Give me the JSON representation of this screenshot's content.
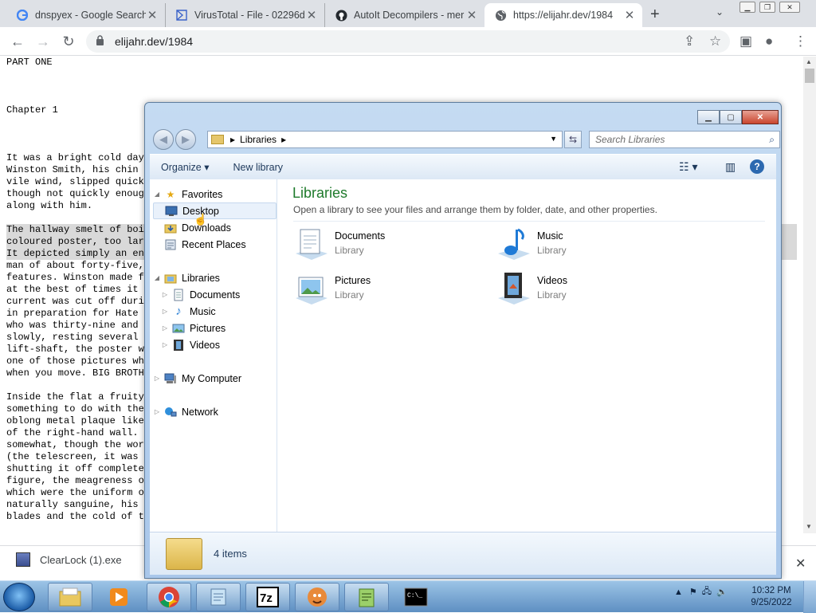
{
  "browser": {
    "tabs": [
      {
        "title": "dnspyex - Google Search",
        "icon": "google-icon"
      },
      {
        "title": "VirusTotal - File - 02296d",
        "icon": "virustotal-icon"
      },
      {
        "title": "AutoIt Decompilers - mer",
        "icon": "github-icon"
      },
      {
        "title": "https://elijahr.dev/1984",
        "icon": "globe-icon",
        "active": true
      }
    ],
    "url": "elijahr.dev/1984"
  },
  "page": {
    "lines": [
      {
        "text": "PART ONE",
        "hl": false
      },
      {
        "text": "",
        "hl": false
      },
      {
        "text": "",
        "hl": false
      },
      {
        "text": "",
        "hl": false
      },
      {
        "text": "Chapter 1",
        "hl": false
      },
      {
        "text": "",
        "hl": false
      },
      {
        "text": "",
        "hl": false
      },
      {
        "text": "",
        "hl": false
      },
      {
        "text": "It was a bright cold day",
        "hl": false
      },
      {
        "text": "Winston Smith, his chin",
        "hl": false
      },
      {
        "text": "vile wind, slipped quick",
        "hl": false
      },
      {
        "text": "though not quickly enoug",
        "hl": false
      },
      {
        "text": "along with him.",
        "hl": false
      },
      {
        "text": "",
        "hl": false
      },
      {
        "text": "The hallway smelt of boi",
        "hl": true
      },
      {
        "text": "coloured poster, too lar",
        "hl": true
      },
      {
        "text": "It depicted simply an en",
        "hl": true
      },
      {
        "text": "man of about forty-five,",
        "hl": false
      },
      {
        "text": "features. Winston made f",
        "hl": false
      },
      {
        "text": "at the best of times it",
        "hl": false
      },
      {
        "text": "current was cut off duri",
        "hl": false
      },
      {
        "text": "in preparation for Hate",
        "hl": false
      },
      {
        "text": "who was thirty-nine and",
        "hl": false
      },
      {
        "text": "slowly, resting several",
        "hl": false
      },
      {
        "text": "lift-shaft, the poster w",
        "hl": false
      },
      {
        "text": "one of those pictures wh",
        "hl": false
      },
      {
        "text": "when you move. BIG BROTH",
        "hl": false
      },
      {
        "text": "",
        "hl": false
      },
      {
        "text": "Inside the flat a fruity",
        "hl": false
      },
      {
        "text": "something to do with the",
        "hl": false
      },
      {
        "text": "oblong metal plaque like",
        "hl": false
      },
      {
        "text": "of the right-hand wall.",
        "hl": false
      },
      {
        "text": "somewhat, though the wor",
        "hl": false
      },
      {
        "text": "(the telescreen, it was",
        "hl": false
      },
      {
        "text": "shutting it off complete",
        "hl": false
      },
      {
        "text": "figure, the meagreness o",
        "hl": false
      },
      {
        "text": "which were the uniform o",
        "hl": false
      },
      {
        "text": "naturally sanguine, his",
        "hl": false
      },
      {
        "text": "blades and the cold of t",
        "hl": false
      }
    ]
  },
  "download": {
    "filename": "ClearLock (1).exe"
  },
  "explorer": {
    "breadcrumb": "Libraries",
    "search_placeholder": "Search Libraries",
    "commands": {
      "organize": "Organize",
      "new_library": "New library"
    },
    "nav": {
      "favorites": "Favorites",
      "desktop": "Desktop",
      "downloads": "Downloads",
      "recent": "Recent Places",
      "libraries": "Libraries",
      "documents": "Documents",
      "music": "Music",
      "pictures": "Pictures",
      "videos": "Videos",
      "computer": "My Computer",
      "network": "Network"
    },
    "content": {
      "title": "Libraries",
      "subtitle": "Open a library to see your files and arrange them by folder, date, and other properties.",
      "items": [
        {
          "name": "Documents",
          "type": "Library",
          "icon": "documents-library-icon"
        },
        {
          "name": "Music",
          "type": "Library",
          "icon": "music-library-icon"
        },
        {
          "name": "Pictures",
          "type": "Library",
          "icon": "pictures-library-icon"
        },
        {
          "name": "Videos",
          "type": "Library",
          "icon": "videos-library-icon"
        }
      ]
    },
    "details": {
      "count": "4 items"
    }
  },
  "taskbar": {
    "clock_time": "10:32 PM",
    "clock_date": "9/25/2022"
  }
}
